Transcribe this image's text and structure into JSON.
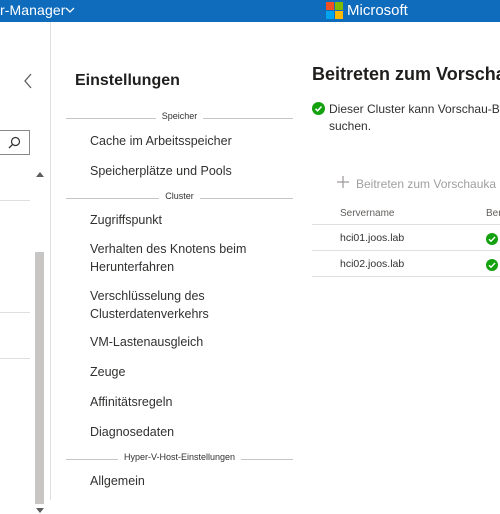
{
  "header": {
    "app_title": "r-Manager",
    "brand": "Microsoft",
    "brand_colors": {
      "red": "#f25022",
      "green": "#7fba00",
      "blue": "#00a4ef",
      "yellow": "#ffb900"
    },
    "bar_color": "#0f6cbd"
  },
  "settings": {
    "title": "Einstellungen",
    "groups": [
      {
        "label": "Speicher",
        "items": [
          "Cache im Arbeitsspeicher",
          "Speicherplätze und Pools"
        ]
      },
      {
        "label": "Cluster",
        "items": [
          "Zugriffspunkt",
          "Verhalten des Knotens beim Herunterfahren",
          "Verschlüsselung des Clusterdatenverkehrs",
          "VM-Lastenausgleich",
          "Zeuge",
          "Affinitätsregeln",
          "Diagnosedaten"
        ]
      },
      {
        "label": "Hyper-V-Host-Einstellungen",
        "items": [
          "Allgemein"
        ]
      }
    ]
  },
  "main": {
    "title": "Beitreten zum Vorschau",
    "status_text": "Dieser Cluster kann Vorschau-B suchen.",
    "join_button": "Beitreten zum Vorschauka",
    "table": {
      "columns": [
        "Servername",
        "Ber"
      ],
      "rows": [
        {
          "server": "hci01.joos.lab",
          "status": "ok"
        },
        {
          "server": "hci02.joos.lab",
          "status": "ok"
        }
      ]
    },
    "status_color": "#13a10e"
  }
}
